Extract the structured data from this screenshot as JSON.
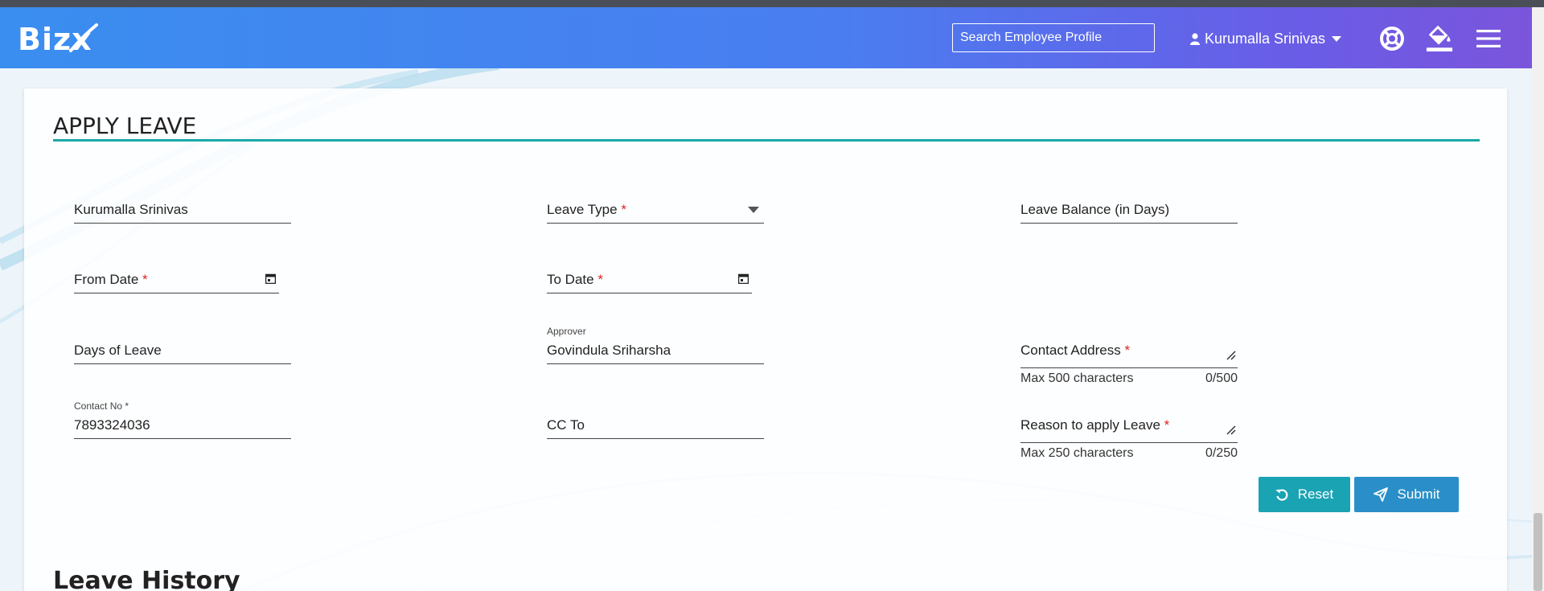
{
  "header": {
    "logo_text": "Bizx",
    "search": {
      "placeholder": "Search Employee Profile",
      "value": ""
    },
    "user_name": "Kurumalla Srinivas",
    "icons": [
      "user-icon",
      "caret-down-icon",
      "help-lifebuoy-icon",
      "paint-bucket-icon",
      "hamburger-menu-icon"
    ]
  },
  "page": {
    "title": "APPLY LEAVE"
  },
  "form": {
    "employee_name": "Kurumalla Srinivas",
    "leave_type_label": "Leave Type",
    "leave_balance_label": "Leave Balance (in Days)",
    "from_date_label": "From Date",
    "to_date_label": "To Date",
    "days_of_leave_label": "Days of Leave",
    "approver_label": "Approver",
    "approver_value": "Govindula Sriharsha",
    "contact_address_label": "Contact Address",
    "contact_address_hint": "Max 500 characters",
    "contact_address_count": "0/500",
    "contact_no_label": "Contact No *",
    "contact_no_value": "7893324036",
    "cc_to_label": "CC To",
    "reason_label": "Reason to apply Leave",
    "reason_hint": "Max 250 characters",
    "reason_count": "0/250",
    "required_marker": "*"
  },
  "actions": {
    "reset_label": "Reset",
    "submit_label": "Submit"
  },
  "history": {
    "title": "Leave History"
  },
  "colors": {
    "header_start": "#3a8ef0",
    "header_end": "#7b55dc",
    "accent_rule": "#1aa8a8",
    "reset_button": "#1aa3b3",
    "submit_button": "#2a8fc8",
    "required": "#dd2222"
  }
}
